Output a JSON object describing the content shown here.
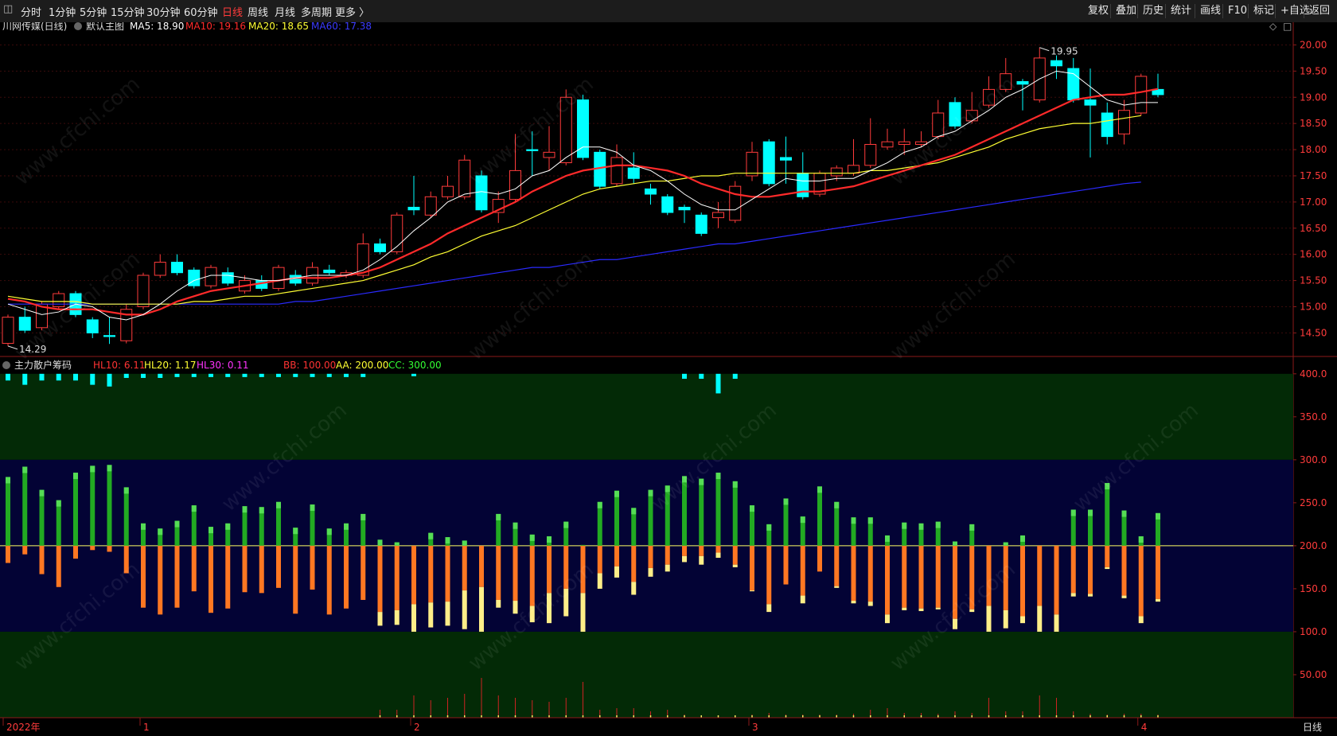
{
  "toolbar": {
    "periods": [
      "分时",
      "1分钟",
      "5分钟",
      "15分钟",
      "30分钟",
      "60分钟",
      "日线",
      "周线",
      "月线",
      "多周期",
      "更多 〉"
    ],
    "active_period": "日线",
    "actions": [
      "复权",
      "叠加",
      "历史",
      "统计",
      "画线",
      "F10",
      "标记",
      "+自选",
      "返回"
    ]
  },
  "main_chart": {
    "title": "川网传媒(日线)",
    "subtitle": "默认主图",
    "ma_labels": [
      {
        "text": "MA5: 18.90",
        "color": "#ffffff"
      },
      {
        "text": "MA10: 19.16",
        "color": "#ff2a2a"
      },
      {
        "text": "MA20: 18.65",
        "color": "#ffff33"
      },
      {
        "text": "MA60: 17.38",
        "color": "#3a3aff"
      }
    ],
    "y_ticks": [
      "20.00",
      "19.50",
      "19.00",
      "18.50",
      "18.00",
      "17.50",
      "17.00",
      "16.50",
      "16.00",
      "15.50",
      "15.00",
      "14.50"
    ],
    "y_range": [
      14.05,
      20.25
    ],
    "high_annotation": "19.95",
    "low_annotation": "14.29",
    "candles": [
      {
        "o": 14.3,
        "c": 14.8,
        "h": 14.85,
        "l": 14.25
      },
      {
        "o": 14.8,
        "c": 14.55,
        "h": 15.0,
        "l": 14.5
      },
      {
        "o": 14.6,
        "c": 15.05,
        "h": 15.1,
        "l": 14.55
      },
      {
        "o": 15.0,
        "c": 15.25,
        "h": 15.3,
        "l": 14.95
      },
      {
        "o": 15.25,
        "c": 14.85,
        "h": 15.3,
        "l": 14.8
      },
      {
        "o": 14.75,
        "c": 14.5,
        "h": 14.8,
        "l": 14.4
      },
      {
        "o": 14.45,
        "c": 14.43,
        "h": 14.8,
        "l": 14.29
      },
      {
        "o": 14.35,
        "c": 14.95,
        "h": 15.05,
        "l": 14.3
      },
      {
        "o": 15.0,
        "c": 15.6,
        "h": 15.65,
        "l": 14.95
      },
      {
        "o": 15.6,
        "c": 15.85,
        "h": 16.0,
        "l": 15.55
      },
      {
        "o": 15.85,
        "c": 15.65,
        "h": 16.0,
        "l": 15.6
      },
      {
        "o": 15.7,
        "c": 15.4,
        "h": 15.75,
        "l": 15.35
      },
      {
        "o": 15.4,
        "c": 15.75,
        "h": 15.8,
        "l": 15.35
      },
      {
        "o": 15.65,
        "c": 15.45,
        "h": 15.75,
        "l": 15.4
      },
      {
        "o": 15.3,
        "c": 15.5,
        "h": 15.6,
        "l": 15.25
      },
      {
        "o": 15.5,
        "c": 15.35,
        "h": 15.6,
        "l": 15.3
      },
      {
        "o": 15.35,
        "c": 15.75,
        "h": 15.8,
        "l": 15.3
      },
      {
        "o": 15.6,
        "c": 15.45,
        "h": 15.7,
        "l": 15.4
      },
      {
        "o": 15.45,
        "c": 15.75,
        "h": 15.85,
        "l": 15.4
      },
      {
        "o": 15.7,
        "c": 15.65,
        "h": 15.8,
        "l": 15.6
      },
      {
        "o": 15.6,
        "c": 15.65,
        "h": 15.7,
        "l": 15.55
      },
      {
        "o": 15.6,
        "c": 16.2,
        "h": 16.4,
        "l": 15.55
      },
      {
        "o": 16.2,
        "c": 16.05,
        "h": 16.3,
        "l": 16.0
      },
      {
        "o": 16.05,
        "c": 16.75,
        "h": 16.8,
        "l": 16.0
      },
      {
        "o": 16.9,
        "c": 16.85,
        "h": 17.5,
        "l": 16.75
      },
      {
        "o": 16.75,
        "c": 17.1,
        "h": 17.2,
        "l": 16.7
      },
      {
        "o": 17.1,
        "c": 17.3,
        "h": 17.5,
        "l": 17.05
      },
      {
        "o": 17.1,
        "c": 17.8,
        "h": 17.9,
        "l": 17.05
      },
      {
        "o": 17.5,
        "c": 16.85,
        "h": 17.6,
        "l": 16.8
      },
      {
        "o": 16.8,
        "c": 17.05,
        "h": 17.2,
        "l": 16.6
      },
      {
        "o": 17.05,
        "c": 17.6,
        "h": 18.3,
        "l": 17.0
      },
      {
        "o": 18.0,
        "c": 17.98,
        "h": 18.35,
        "l": 17.5
      },
      {
        "o": 17.85,
        "c": 17.95,
        "h": 18.45,
        "l": 17.6
      },
      {
        "o": 17.75,
        "c": 19.0,
        "h": 19.15,
        "l": 17.7
      },
      {
        "o": 18.95,
        "c": 17.85,
        "h": 19.05,
        "l": 17.8
      },
      {
        "o": 17.95,
        "c": 17.3,
        "h": 18.0,
        "l": 17.25
      },
      {
        "o": 17.35,
        "c": 17.85,
        "h": 18.1,
        "l": 17.3
      },
      {
        "o": 17.65,
        "c": 17.45,
        "h": 17.95,
        "l": 17.35
      },
      {
        "o": 17.25,
        "c": 17.15,
        "h": 17.35,
        "l": 16.95
      },
      {
        "o": 17.1,
        "c": 16.8,
        "h": 17.15,
        "l": 16.75
      },
      {
        "o": 16.9,
        "c": 16.85,
        "h": 16.95,
        "l": 16.6
      },
      {
        "o": 16.75,
        "c": 16.4,
        "h": 16.8,
        "l": 16.35
      },
      {
        "o": 16.7,
        "c": 16.8,
        "h": 17.0,
        "l": 16.5
      },
      {
        "o": 16.65,
        "c": 17.3,
        "h": 17.4,
        "l": 16.6
      },
      {
        "o": 17.5,
        "c": 17.95,
        "h": 18.15,
        "l": 17.4
      },
      {
        "o": 18.15,
        "c": 17.35,
        "h": 18.2,
        "l": 17.3
      },
      {
        "o": 17.85,
        "c": 17.8,
        "h": 18.25,
        "l": 17.35
      },
      {
        "o": 17.55,
        "c": 17.1,
        "h": 17.95,
        "l": 17.05
      },
      {
        "o": 17.15,
        "c": 17.55,
        "h": 17.6,
        "l": 17.1
      },
      {
        "o": 17.5,
        "c": 17.65,
        "h": 17.7,
        "l": 17.4
      },
      {
        "o": 17.55,
        "c": 17.7,
        "h": 18.2,
        "l": 17.5
      },
      {
        "o": 17.7,
        "c": 18.1,
        "h": 18.6,
        "l": 17.65
      },
      {
        "o": 18.05,
        "c": 18.15,
        "h": 18.4,
        "l": 18.0
      },
      {
        "o": 18.1,
        "c": 18.15,
        "h": 18.4,
        "l": 17.9
      },
      {
        "o": 18.1,
        "c": 18.15,
        "h": 18.35,
        "l": 18.05
      },
      {
        "o": 18.25,
        "c": 18.7,
        "h": 18.95,
        "l": 18.2
      },
      {
        "o": 18.9,
        "c": 18.45,
        "h": 19.0,
        "l": 18.4
      },
      {
        "o": 18.55,
        "c": 18.75,
        "h": 19.1,
        "l": 18.5
      },
      {
        "o": 18.85,
        "c": 19.15,
        "h": 19.4,
        "l": 18.8
      },
      {
        "o": 19.15,
        "c": 19.45,
        "h": 19.75,
        "l": 19.1
      },
      {
        "o": 19.3,
        "c": 19.25,
        "h": 19.35,
        "l": 18.75
      },
      {
        "o": 18.95,
        "c": 19.75,
        "h": 19.95,
        "l": 18.9
      },
      {
        "o": 19.7,
        "c": 19.6,
        "h": 19.8,
        "l": 19.35
      },
      {
        "o": 19.55,
        "c": 18.95,
        "h": 19.75,
        "l": 18.9
      },
      {
        "o": 18.95,
        "c": 18.85,
        "h": 19.55,
        "l": 17.85
      },
      {
        "o": 18.7,
        "c": 18.25,
        "h": 18.9,
        "l": 18.1
      },
      {
        "o": 18.3,
        "c": 18.75,
        "h": 18.95,
        "l": 18.1
      },
      {
        "o": 18.7,
        "c": 19.4,
        "h": 19.45,
        "l": 18.65
      },
      {
        "o": 19.15,
        "c": 19.05,
        "h": 19.45,
        "l": 19.0
      }
    ],
    "ma5": [
      15.05,
      14.95,
      14.85,
      14.9,
      15.05,
      15.0,
      14.8,
      14.75,
      14.85,
      15.05,
      15.3,
      15.5,
      15.6,
      15.6,
      15.55,
      15.5,
      15.5,
      15.55,
      15.6,
      15.6,
      15.6,
      15.7,
      15.9,
      16.15,
      16.45,
      16.7,
      17.0,
      17.15,
      17.2,
      17.15,
      17.25,
      17.5,
      17.6,
      17.85,
      18.05,
      18.05,
      17.95,
      17.7,
      17.6,
      17.4,
      17.15,
      16.95,
      16.85,
      16.85,
      17.05,
      17.25,
      17.45,
      17.4,
      17.4,
      17.45,
      17.45,
      17.6,
      17.75,
      17.95,
      18.05,
      18.25,
      18.35,
      18.55,
      18.75,
      19.0,
      19.15,
      19.35,
      19.5,
      19.45,
      19.2,
      18.95,
      18.85,
      18.9,
      18.9
    ],
    "ma10": [
      15.15,
      15.1,
      15.0,
      14.95,
      14.95,
      14.95,
      14.9,
      14.85,
      14.85,
      14.95,
      15.1,
      15.2,
      15.3,
      15.35,
      15.4,
      15.45,
      15.5,
      15.55,
      15.55,
      15.55,
      15.6,
      15.65,
      15.75,
      15.9,
      16.05,
      16.2,
      16.4,
      16.55,
      16.7,
      16.85,
      17.0,
      17.2,
      17.35,
      17.5,
      17.6,
      17.65,
      17.7,
      17.7,
      17.65,
      17.6,
      17.5,
      17.35,
      17.25,
      17.15,
      17.1,
      17.1,
      17.15,
      17.2,
      17.2,
      17.25,
      17.3,
      17.4,
      17.5,
      17.6,
      17.7,
      17.8,
      17.9,
      18.05,
      18.2,
      18.35,
      18.5,
      18.65,
      18.8,
      18.95,
      19.0,
      19.05,
      19.05,
      19.1,
      19.16
    ],
    "ma20": [
      15.2,
      15.15,
      15.1,
      15.1,
      15.1,
      15.05,
      15.05,
      15.05,
      15.05,
      15.05,
      15.05,
      15.1,
      15.1,
      15.15,
      15.2,
      15.2,
      15.25,
      15.3,
      15.35,
      15.4,
      15.45,
      15.5,
      15.6,
      15.7,
      15.8,
      15.95,
      16.05,
      16.2,
      16.35,
      16.45,
      16.55,
      16.7,
      16.85,
      17.0,
      17.15,
      17.25,
      17.3,
      17.35,
      17.4,
      17.4,
      17.45,
      17.5,
      17.5,
      17.55,
      17.55,
      17.55,
      17.55,
      17.55,
      17.55,
      17.55,
      17.55,
      17.6,
      17.6,
      17.65,
      17.7,
      17.75,
      17.85,
      17.95,
      18.05,
      18.2,
      18.3,
      18.4,
      18.45,
      18.5,
      18.5,
      18.55,
      18.6,
      18.65
    ],
    "ma60": [
      15.05,
      15.05,
      15.05,
      15.05,
      15.05,
      15.05,
      15.05,
      15.05,
      15.05,
      15.05,
      15.05,
      15.05,
      15.05,
      15.05,
      15.05,
      15.05,
      15.05,
      15.1,
      15.1,
      15.15,
      15.2,
      15.25,
      15.3,
      15.35,
      15.4,
      15.45,
      15.5,
      15.55,
      15.6,
      15.65,
      15.7,
      15.75,
      15.75,
      15.8,
      15.85,
      15.9,
      15.9,
      15.95,
      16.0,
      16.05,
      16.1,
      16.15,
      16.2,
      16.2,
      16.25,
      16.3,
      16.35,
      16.4,
      16.45,
      16.5,
      16.55,
      16.6,
      16.65,
      16.7,
      16.75,
      16.8,
      16.85,
      16.9,
      16.95,
      17.0,
      17.05,
      17.1,
      17.15,
      17.2,
      17.25,
      17.3,
      17.35,
      17.38
    ]
  },
  "indicator": {
    "title": "主力散户筹码",
    "labels": [
      {
        "text": "HL10: 6.11",
        "color": "#ff3333"
      },
      {
        "text": "HL20: 1.17",
        "color": "#ffff33"
      },
      {
        "text": "HL30: 0.11",
        "color": "#ff33ff"
      },
      {
        "text": "BB: 100.00",
        "color": "#ff3333"
      },
      {
        "text": "AA: 200.00",
        "color": "#ffff33"
      },
      {
        "text": "CC: 300.00",
        "color": "#33ff33"
      }
    ],
    "y_ticks": [
      "400.0",
      "350.0",
      "300.0",
      "250.0",
      "200.0",
      "150.0",
      "100.0",
      "50.00"
    ],
    "y_range": [
      0,
      410
    ],
    "bars": [
      {
        "t": 280,
        "o": 180,
        "y": 180,
        "s": 395,
        "v": 0
      },
      {
        "t": 292,
        "o": 190,
        "y": 190,
        "s": 390,
        "v": 0
      },
      {
        "t": 265,
        "o": 167,
        "y": 167,
        "s": 395,
        "v": 0
      },
      {
        "t": 253,
        "o": 152,
        "y": 152,
        "s": 395,
        "v": 0
      },
      {
        "t": 285,
        "o": 185,
        "y": 185,
        "s": 395,
        "v": 0
      },
      {
        "t": 293,
        "o": 195,
        "y": 195,
        "s": 390,
        "v": 0
      },
      {
        "t": 294,
        "o": 193,
        "y": 193,
        "s": 388,
        "v": 0
      },
      {
        "t": 268,
        "o": 168,
        "y": 168,
        "s": 398,
        "v": 0
      },
      {
        "t": 226,
        "o": 128,
        "y": 128,
        "s": 398,
        "v": 0
      },
      {
        "t": 220,
        "o": 120,
        "y": 120,
        "s": 398,
        "v": 0
      },
      {
        "t": 229,
        "o": 128,
        "y": 128,
        "s": 399,
        "v": 0
      },
      {
        "t": 247,
        "o": 147,
        "y": 147,
        "s": 399,
        "v": 0
      },
      {
        "t": 222,
        "o": 122,
        "y": 122,
        "s": 399,
        "v": 0
      },
      {
        "t": 226,
        "o": 127,
        "y": 127,
        "s": 399,
        "v": 0
      },
      {
        "t": 246,
        "o": 146,
        "y": 146,
        "s": 399,
        "v": 0
      },
      {
        "t": 245,
        "o": 145,
        "y": 145,
        "s": 399,
        "v": 0
      },
      {
        "t": 251,
        "o": 151,
        "y": 151,
        "s": 399,
        "v": 0
      },
      {
        "t": 221,
        "o": 121,
        "y": 121,
        "s": 399,
        "v": 0
      },
      {
        "t": 248,
        "o": 149,
        "y": 149,
        "s": 399,
        "v": 0
      },
      {
        "t": 220,
        "o": 120,
        "y": 120,
        "s": 399,
        "v": 0
      },
      {
        "t": 226,
        "o": 127,
        "y": 127,
        "s": 399,
        "v": 0
      },
      {
        "t": 237,
        "o": 137,
        "y": 137,
        "s": 399,
        "v": 0
      },
      {
        "t": 207,
        "o": 123,
        "y": 107,
        "s": 0,
        "v": 10
      },
      {
        "t": 204,
        "o": 125,
        "y": 108,
        "s": 0,
        "v": 10
      },
      {
        "t": 200,
        "o": 132,
        "y": 100,
        "s": 400,
        "v": 28
      },
      {
        "t": 215,
        "o": 134,
        "y": 105,
        "s": 0,
        "v": 22
      },
      {
        "t": 210,
        "o": 135,
        "y": 107,
        "s": 0,
        "v": 25
      },
      {
        "t": 206,
        "o": 148,
        "y": 103,
        "s": 0,
        "v": 30
      },
      {
        "t": 200,
        "o": 152,
        "y": 100,
        "s": 0,
        "v": 50
      },
      {
        "t": 237,
        "o": 137,
        "y": 128,
        "s": 0,
        "v": 28
      },
      {
        "t": 227,
        "o": 136,
        "y": 121,
        "s": 0,
        "v": 25
      },
      {
        "t": 213,
        "o": 130,
        "y": 111,
        "s": 0,
        "v": 22
      },
      {
        "t": 211,
        "o": 145,
        "y": 110,
        "s": 0,
        "v": 20
      },
      {
        "t": 228,
        "o": 150,
        "y": 118,
        "s": 0,
        "v": 25
      },
      {
        "t": 201,
        "o": 145,
        "y": 100,
        "s": 0,
        "v": 45
      },
      {
        "t": 251,
        "o": 168,
        "y": 150,
        "s": 0,
        "v": 10
      },
      {
        "t": 264,
        "o": 176,
        "y": 163,
        "s": 0,
        "v": 12
      },
      {
        "t": 244,
        "o": 158,
        "y": 143,
        "s": 0,
        "v": 12
      },
      {
        "t": 265,
        "o": 174,
        "y": 164,
        "s": 0,
        "v": 8
      },
      {
        "t": 270,
        "o": 178,
        "y": 170,
        "s": 0,
        "v": 10
      },
      {
        "t": 281,
        "o": 188,
        "y": 181,
        "s": 397,
        "v": 4
      },
      {
        "t": 278,
        "o": 188,
        "y": 178,
        "s": 397,
        "v": 3
      },
      {
        "t": 285,
        "o": 192,
        "y": 186,
        "s": 380,
        "v": 3
      },
      {
        "t": 275,
        "o": 178,
        "y": 175,
        "s": 397,
        "v": 3
      },
      {
        "t": 247,
        "o": 148,
        "y": 147,
        "s": 0,
        "v": 4
      },
      {
        "t": 225,
        "o": 132,
        "y": 123,
        "s": 0,
        "v": 6
      },
      {
        "t": 255,
        "o": 155,
        "y": 155,
        "s": 0,
        "v": 4
      },
      {
        "t": 234,
        "o": 142,
        "y": 133,
        "s": 0,
        "v": 4
      },
      {
        "t": 269,
        "o": 170,
        "y": 170,
        "s": 0,
        "v": 4
      },
      {
        "t": 251,
        "o": 153,
        "y": 151,
        "s": 0,
        "v": 4
      },
      {
        "t": 233,
        "o": 136,
        "y": 133,
        "s": 0,
        "v": 5
      },
      {
        "t": 233,
        "o": 135,
        "y": 130,
        "s": 0,
        "v": 10
      },
      {
        "t": 212,
        "o": 120,
        "y": 110,
        "s": 0,
        "v": 12
      },
      {
        "t": 227,
        "o": 128,
        "y": 125,
        "s": 0,
        "v": 6
      },
      {
        "t": 226,
        "o": 127,
        "y": 124,
        "s": 0,
        "v": 6
      },
      {
        "t": 228,
        "o": 128,
        "y": 126,
        "s": 0,
        "v": 5
      },
      {
        "t": 205,
        "o": 115,
        "y": 103,
        "s": 0,
        "v": 8
      },
      {
        "t": 225,
        "o": 126,
        "y": 123,
        "s": 0,
        "v": 6
      },
      {
        "t": 200,
        "o": 130,
        "y": 100,
        "s": 0,
        "v": 25
      },
      {
        "t": 204,
        "o": 125,
        "y": 104,
        "s": 0,
        "v": 8
      },
      {
        "t": 212,
        "o": 118,
        "y": 110,
        "s": 0,
        "v": 8
      },
      {
        "t": 200,
        "o": 130,
        "y": 100,
        "s": 0,
        "v": 28
      },
      {
        "t": 200,
        "o": 120,
        "y": 100,
        "s": 0,
        "v": 25
      },
      {
        "t": 242,
        "o": 145,
        "y": 141,
        "s": 0,
        "v": 8
      },
      {
        "t": 242,
        "o": 144,
        "y": 141,
        "s": 0,
        "v": 5
      },
      {
        "t": 273,
        "o": 175,
        "y": 173,
        "s": 0,
        "v": 4
      },
      {
        "t": 241,
        "o": 142,
        "y": 139,
        "s": 0,
        "v": 5
      },
      {
        "t": 211,
        "o": 118,
        "y": 110,
        "s": 0,
        "v": 5
      },
      {
        "t": 238,
        "o": 138,
        "y": 135,
        "s": 0,
        "v": 4
      }
    ]
  },
  "x_axis": {
    "labels": [
      {
        "text": "2022年",
        "idx": 0
      },
      {
        "text": "1",
        "idx": 8
      },
      {
        "text": "2",
        "idx": 24
      },
      {
        "text": "3",
        "idx": 44
      },
      {
        "text": "4",
        "idx": 67
      }
    ],
    "period_label": "日线"
  },
  "watermark": "www.cfchi.com",
  "colors": {
    "up": "#ff3b3b",
    "down": "#00ffff",
    "ma5": "#ffffff",
    "ma10": "#ff2a2a",
    "ma20": "#ffff33",
    "ma60": "#2a2aff",
    "zone_green": "#032a06",
    "zone_blue": "#030335",
    "bar_green": "#22aa22",
    "bar_orange": "#ff7722",
    "bar_light": "#ffee88"
  }
}
